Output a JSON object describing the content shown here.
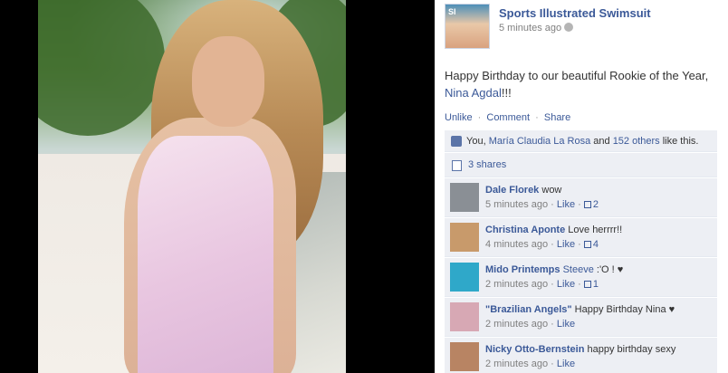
{
  "post": {
    "page_name": "Sports Illustrated Swimsuit",
    "time": "5 minutes ago",
    "text_prefix": "Happy Birthday to our beautiful Rookie of the Year,",
    "tagged_name": "Nina Agdal",
    "text_suffix": "!!!",
    "avatar_text": "SI",
    "icons": {
      "privacy": "globe-icon",
      "like": "thumbs-up-icon",
      "share": "share-icon"
    }
  },
  "actions": {
    "unlike": "Unlike",
    "comment": "Comment",
    "share": "Share",
    "separator": "·"
  },
  "likes": {
    "you": "You,",
    "name": "María Claudia La Rosa",
    "and": "and",
    "others": "152 others",
    "suffix": "like this."
  },
  "shares": {
    "label": "3 shares"
  },
  "comments": [
    {
      "name": "Dale Florek",
      "text": "wow",
      "time": "5 minutes ago",
      "like_label": "Like",
      "likes": "2",
      "avatar_color": "#8a8f95"
    },
    {
      "name": "Christina Aponte",
      "text": "Love herrrr!!",
      "time": "4 minutes ago",
      "like_label": "Like",
      "likes": "4",
      "avatar_color": "#c89a6b"
    },
    {
      "name": "Mido Printemps",
      "mention": "Steeve",
      "text": " :'O ! ♥",
      "time": "2 minutes ago",
      "like_label": "Like",
      "likes": "1",
      "avatar_color": "#2fa8c9"
    },
    {
      "name": "\"Brazilian Angels\"",
      "text": "Happy Birthday Nina ♥",
      "time": "2 minutes ago",
      "like_label": "Like",
      "avatar_color": "#d7a8b4"
    },
    {
      "name": "Nicky Otto-Bernstein",
      "text": "happy birthday sexy",
      "time": "2 minutes ago",
      "like_label": "Like",
      "avatar_color": "#b88463"
    }
  ],
  "colors": {
    "link": "#3b5998",
    "ufi_bg": "#edeff4"
  }
}
